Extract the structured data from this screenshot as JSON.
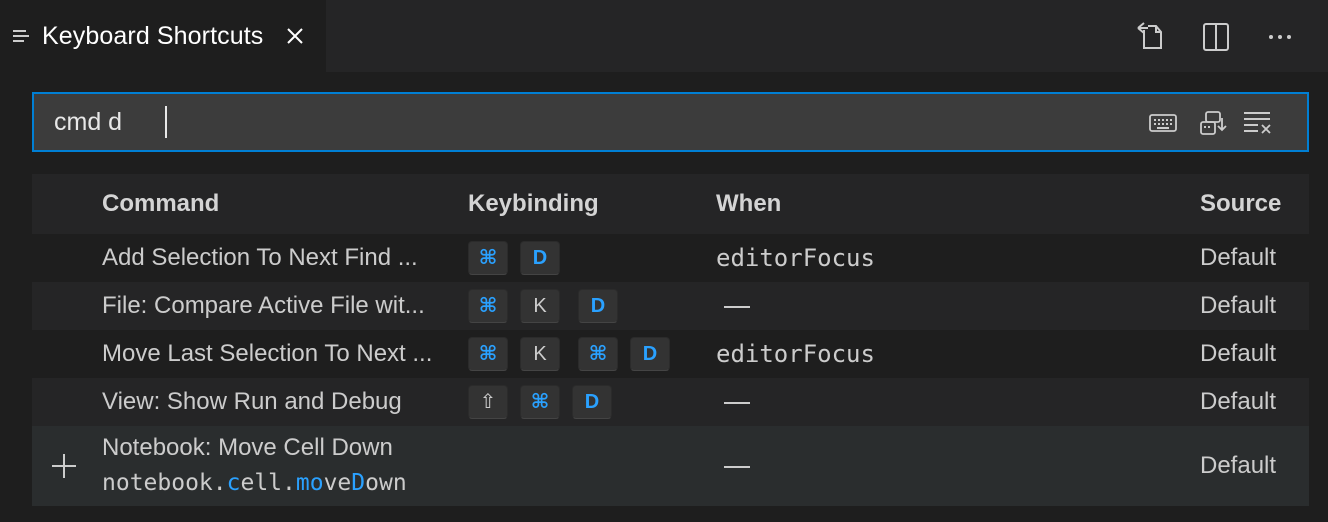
{
  "tab": {
    "title": "Keyboard Shortcuts"
  },
  "search": {
    "value": "cmd d"
  },
  "table": {
    "headers": {
      "command": "Command",
      "keybinding": "Keybinding",
      "when": "When",
      "source": "Source"
    },
    "rows": [
      {
        "command": "Add Selection To Next Find ...",
        "keys": [
          "⌘",
          "D"
        ],
        "when": "editorFocus",
        "source": "Default"
      },
      {
        "command": "File: Compare Active File wit...",
        "keys": [
          "⌘",
          "K",
          "D"
        ],
        "when": "—",
        "source": "Default"
      },
      {
        "command": "Move Last Selection To Next ...",
        "keys": [
          "⌘",
          "K",
          "⌘",
          "D"
        ],
        "when": "editorFocus",
        "source": "Default"
      },
      {
        "command": "View: Show Run and Debug",
        "keys": [
          "⇧",
          "⌘",
          "D"
        ],
        "when": "—",
        "source": "Default"
      }
    ],
    "selected_row": {
      "command": "Notebook: Move Cell Down",
      "command_id_parts": [
        "notebook.",
        "c",
        "ell.",
        "mo",
        "ve",
        "D",
        "own"
      ],
      "when": "—",
      "source": "Default"
    }
  },
  "colors": {
    "accent": "#007fd4",
    "key_highlight": "#2aa1ff",
    "background": "#1e1e1e"
  },
  "icons": {
    "tab_icon": "keyboard-shortcuts-list-icon",
    "actions": [
      "open-json-icon",
      "split-editor-icon",
      "more-actions-icon"
    ],
    "search_actions": [
      "record-keys-icon",
      "sort-by-precedence-icon",
      "clear-input-icon"
    ]
  }
}
